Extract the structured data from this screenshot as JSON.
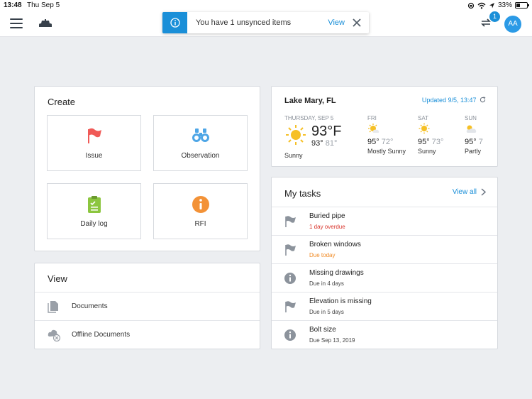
{
  "status": {
    "time": "13:48",
    "date": "Thu Sep 5",
    "battery": "33%"
  },
  "header": {
    "sync_count": "1",
    "avatar_initials": "AA"
  },
  "toast": {
    "message": "You have 1 unsynced items",
    "action": "View"
  },
  "create": {
    "title": "Create",
    "tiles": [
      {
        "label": "Issue",
        "icon": "flag-icon",
        "color": "#f05a57"
      },
      {
        "label": "Observation",
        "icon": "binoculars-icon",
        "color": "#4ea6e6"
      },
      {
        "label": "Daily log",
        "icon": "clipboard-icon",
        "color": "#8cc63f"
      },
      {
        "label": "RFI",
        "icon": "info-icon",
        "color": "#f39237"
      }
    ]
  },
  "view": {
    "title": "View",
    "items": [
      {
        "label": "Documents",
        "icon": "document-icon"
      },
      {
        "label": "Offline Documents",
        "icon": "offline-cloud-icon"
      }
    ]
  },
  "weather": {
    "location": "Lake Mary, FL",
    "updated": "Updated 9/5, 13:47",
    "today": {
      "name": "THURSDAY, SEP 5",
      "temp": "93°F",
      "high": "93°",
      "low": "81°",
      "condition": "Sunny",
      "icon": "sun-icon"
    },
    "forecast": [
      {
        "name": "FRI",
        "high": "95°",
        "low": "72°",
        "condition": "Mostly Sunny",
        "icon": "partly-sunny-icon"
      },
      {
        "name": "SAT",
        "high": "95°",
        "low": "73°",
        "condition": "Sunny",
        "icon": "sun-icon"
      },
      {
        "name": "SUN",
        "high": "95°",
        "low": "7",
        "condition": "Partly",
        "icon": "partly-cloudy-icon"
      }
    ]
  },
  "tasks": {
    "title": "My tasks",
    "view_all": "View all",
    "items": [
      {
        "name": "Buried pipe",
        "due": "1 day overdue",
        "due_color": "#d9342b",
        "icon": "flag-icon"
      },
      {
        "name": "Broken windows",
        "due": "Due today",
        "due_color": "#f08a24",
        "icon": "flag-icon"
      },
      {
        "name": "Missing drawings",
        "due": "Due in 4 days",
        "due_color": "#444444",
        "icon": "info-icon"
      },
      {
        "name": "Elevation is missing",
        "due": "Due in 5 days",
        "due_color": "#444444",
        "icon": "flag-icon"
      },
      {
        "name": "Bolt size",
        "due": "Due Sep 13, 2019",
        "due_color": "#444444",
        "icon": "info-icon"
      }
    ]
  }
}
